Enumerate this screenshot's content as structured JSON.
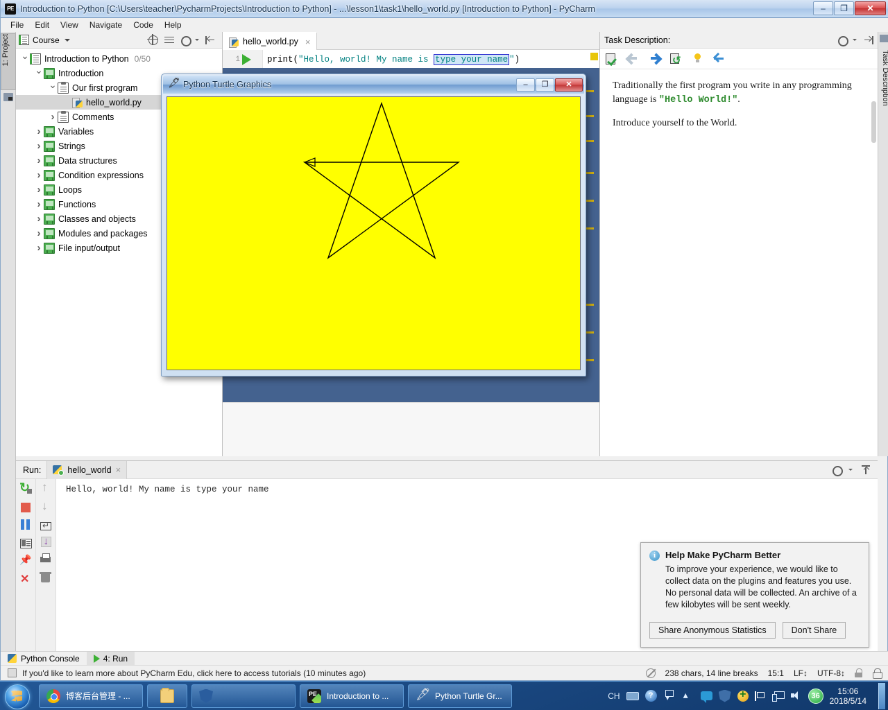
{
  "window": {
    "title": "Introduction to Python [C:\\Users\\teacher\\PycharmProjects\\Introduction to Python] - ...\\lesson1\\task1\\hello_world.py [Introduction to Python] - PyCharm",
    "app_icon": "PE",
    "minimize": "–",
    "maximize": "❐",
    "close": "✕"
  },
  "menubar": {
    "items": [
      {
        "label": "File"
      },
      {
        "label": "Edit"
      },
      {
        "label": "View"
      },
      {
        "label": "Navigate"
      },
      {
        "label": "Code"
      },
      {
        "label": "Help"
      }
    ]
  },
  "left_strip": {
    "project_tab": "1: Project"
  },
  "course_panel": {
    "header_title": "Course",
    "tree": [
      {
        "label": "Introduction to Python",
        "count": "0/50",
        "indent": 0,
        "twist": "down",
        "icon": "course-root-icon",
        "selected": false
      },
      {
        "label": "Introduction",
        "count": "",
        "indent": 1,
        "twist": "down",
        "icon": "lesson-board-icon",
        "selected": false
      },
      {
        "label": "Our first program",
        "count": "",
        "indent": 2,
        "twist": "down",
        "icon": "task-clipboard-icon",
        "selected": false
      },
      {
        "label": "hello_world.py",
        "count": "",
        "indent": 3,
        "twist": "none",
        "icon": "python-file-icon",
        "selected": true
      },
      {
        "label": "Comments",
        "count": "",
        "indent": 2,
        "twist": "right",
        "icon": "task-clipboard-icon",
        "selected": false
      },
      {
        "label": "Variables",
        "count": "",
        "indent": 1,
        "twist": "right",
        "icon": "lesson-board-icon",
        "selected": false
      },
      {
        "label": "Strings",
        "count": "",
        "indent": 1,
        "twist": "right",
        "icon": "lesson-board-icon",
        "selected": false
      },
      {
        "label": "Data structures",
        "count": "",
        "indent": 1,
        "twist": "right",
        "icon": "lesson-board-icon",
        "selected": false
      },
      {
        "label": "Condition expressions",
        "count": "",
        "indent": 1,
        "twist": "right",
        "icon": "lesson-board-icon",
        "selected": false
      },
      {
        "label": "Loops",
        "count": "",
        "indent": 1,
        "twist": "right",
        "icon": "lesson-board-icon",
        "selected": false
      },
      {
        "label": "Functions",
        "count": "",
        "indent": 1,
        "twist": "right",
        "icon": "lesson-board-icon",
        "selected": false
      },
      {
        "label": "Classes and objects",
        "count": "",
        "indent": 1,
        "twist": "right",
        "icon": "lesson-board-icon",
        "selected": false
      },
      {
        "label": "Modules and packages",
        "count": "",
        "indent": 1,
        "twist": "right",
        "icon": "lesson-board-icon",
        "selected": false
      },
      {
        "label": "File input/output",
        "count": "",
        "indent": 1,
        "twist": "right",
        "icon": "lesson-board-icon",
        "selected": false
      }
    ]
  },
  "editor": {
    "tab_label": "hello_world.py",
    "tab_close": "×",
    "line_number": "1",
    "code": {
      "fn": "print",
      "open_paren": "(",
      "str_before": "\"Hello, world! My name is ",
      "placeholder": "type your name",
      "str_after": "\"",
      "close_paren": ")"
    }
  },
  "task_description": {
    "header": "Task Description:",
    "vertical_tab": "Task Description",
    "paragraph1_a": "Traditionally the first program you write in any programming language is ",
    "paragraph1_code": "\"Hello World!\"",
    "paragraph1_b": ".",
    "paragraph2": "Introduce yourself to the World.",
    "toolbar": [
      {
        "name": "check-task-icon"
      },
      {
        "name": "previous-task-icon"
      },
      {
        "name": "next-task-icon"
      },
      {
        "name": "refresh-task-icon"
      },
      {
        "name": "hint-bulb-icon"
      },
      {
        "name": "collapse-icon"
      }
    ]
  },
  "turtle_window": {
    "title": "Python Turtle Graphics",
    "minimize": "–",
    "maximize": "❐",
    "close": "✕",
    "canvas_color": "#ffff00",
    "drawing": "pentagram-star"
  },
  "run_window": {
    "label": "Run:",
    "tab_label": "hello_world",
    "tab_close": "×",
    "console_output": "Hello, world! My name is type your name",
    "tools_left": [
      {
        "name": "rerun-icon"
      },
      {
        "name": "stop-icon"
      },
      {
        "name": "pause-icon"
      },
      {
        "name": "console-icon"
      },
      {
        "name": "pin-icon"
      },
      {
        "name": "close-icon"
      }
    ],
    "tools_right": [
      {
        "name": "scroll-up-icon"
      },
      {
        "name": "scroll-down-icon"
      },
      {
        "name": "soft-wrap-icon"
      },
      {
        "name": "scroll-to-end-icon"
      },
      {
        "name": "print-icon"
      },
      {
        "name": "clear-all-icon"
      }
    ]
  },
  "notification": {
    "title": "Help Make PyCharm Better",
    "body": "To improve your experience, we would like to collect data on the plugins and features you use. No personal data will be collected. An archive of a few kilobytes will be sent weekly.",
    "primary_button": "Share Anonymous Statistics",
    "secondary_button": "Don't Share"
  },
  "tool_tabs": [
    {
      "label": "Python Console",
      "active": false
    },
    {
      "label": "4: Run",
      "active": true
    }
  ],
  "statusbar": {
    "message": "If you'd like to learn more about PyCharm Edu, click here to access tutorials (10 minutes ago)",
    "chars": "238 chars, 14 line breaks",
    "caret": "15:1",
    "line_sep": "LF↕",
    "encoding": "UTF-8↕"
  },
  "taskbar": {
    "start": "start-orb",
    "items": [
      {
        "label": "博客后台管理 - ...",
        "icon": "chrome-icon",
        "small": false
      },
      {
        "label": "",
        "icon": "folder-explorer-icon",
        "small": true
      },
      {
        "label": "",
        "icon": "shield-icon",
        "small": false
      },
      {
        "label": "Introduction to ...",
        "icon": "pycharm-edu-icon",
        "small": false
      },
      {
        "label": "Python Turtle Gr...",
        "icon": "feather-icon",
        "small": false
      }
    ],
    "tray_lang": "CH",
    "tray_badge": "36",
    "clock_time": "15:06",
    "clock_date": "2018/5/14"
  }
}
